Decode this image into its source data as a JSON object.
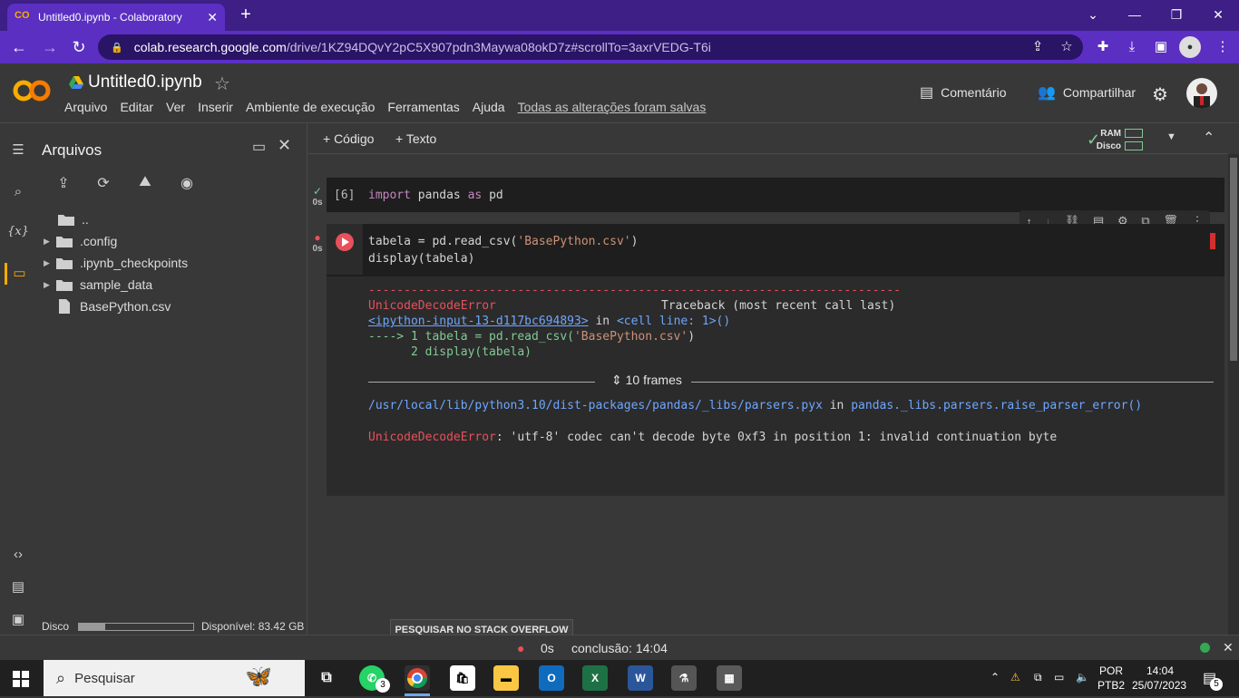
{
  "browser": {
    "tab_title": "Untitled0.ipynb - Colaboratory",
    "url_host": "colab.research.google.com",
    "url_path": "/drive/1KZ94DQvY2pC5X907pdn3Maywa08okD7z#scrollTo=3axrVEDG-T6i"
  },
  "colab": {
    "notebook_title": "Untitled0.ipynb",
    "menu": [
      "Arquivo",
      "Editar",
      "Ver",
      "Inserir",
      "Ambiente de execução",
      "Ferramentas",
      "Ajuda"
    ],
    "saved_status": "Todas as alterações foram salvas",
    "comment_label": "Comentário",
    "share_label": "Compartilhar"
  },
  "files_panel": {
    "title": "Arquivos",
    "tree": [
      {
        "name": "..",
        "type": "up"
      },
      {
        "name": ".config",
        "type": "folder"
      },
      {
        "name": ".ipynb_checkpoints",
        "type": "folder"
      },
      {
        "name": "sample_data",
        "type": "folder"
      },
      {
        "name": "BasePython.csv",
        "type": "file"
      }
    ],
    "disk_label": "Disco",
    "disk_available": "Disponível: 83.42 GB",
    "disk_used_fraction": 0.23
  },
  "toolbar": {
    "add_code": "+ Código",
    "add_text": "+ Texto",
    "ram_label": "RAM",
    "disk_label": "Disco"
  },
  "cells": {
    "cell1": {
      "exec_count": "[6]",
      "time": "0s",
      "kw1": "import",
      "mid": " pandas ",
      "kw2": "as",
      "end": " pd"
    },
    "cell2": {
      "time": "0s",
      "line1_pre": "tabela = pd.read_csv(",
      "line1_str": "'BasePython.csv'",
      "line1_post": ")",
      "line2": "display(tabela)"
    }
  },
  "output": {
    "dashes": "---------------------------------------------------------------------------",
    "error_name": "UnicodeDecodeError",
    "traceback_label": "Traceback (most recent call last)",
    "input_link": "<ipython-input-13-d117bc694893>",
    "in_text": " in ",
    "cell_line": "<cell line: 1>()",
    "arrow_line": "----> 1 tabela = pd.read_csv(",
    "arrow_str": "'BasePython.csv'",
    "arrow_end": ")",
    "line2": "      2 display(tabela)",
    "frames": "10 frames",
    "lib_path": "/usr/local/lib/python3.10/dist-packages/pandas/_libs/parsers.pyx",
    "lib_in": " in ",
    "lib_func": "pandas._libs.parsers.raise_parser_error()",
    "err_msg": ": 'utf-8' codec can't decode byte 0xf3 in position 1: invalid continuation byte",
    "so_button": "PESQUISAR NO STACK OVERFLOW"
  },
  "statusbar": {
    "time": "0s",
    "completion": "conclusão: 14:04"
  },
  "taskbar": {
    "search_placeholder": "Pesquisar",
    "whatsapp_badge": "3",
    "lang1": "POR",
    "lang2": "PTB2",
    "clock_time": "14:04",
    "clock_date": "25/07/2023",
    "notif_count": "5"
  },
  "colors": {
    "browser_frame": "#3d1f86",
    "accent": "#f9ab00",
    "error": "#e8505b",
    "ok": "#81c995"
  }
}
